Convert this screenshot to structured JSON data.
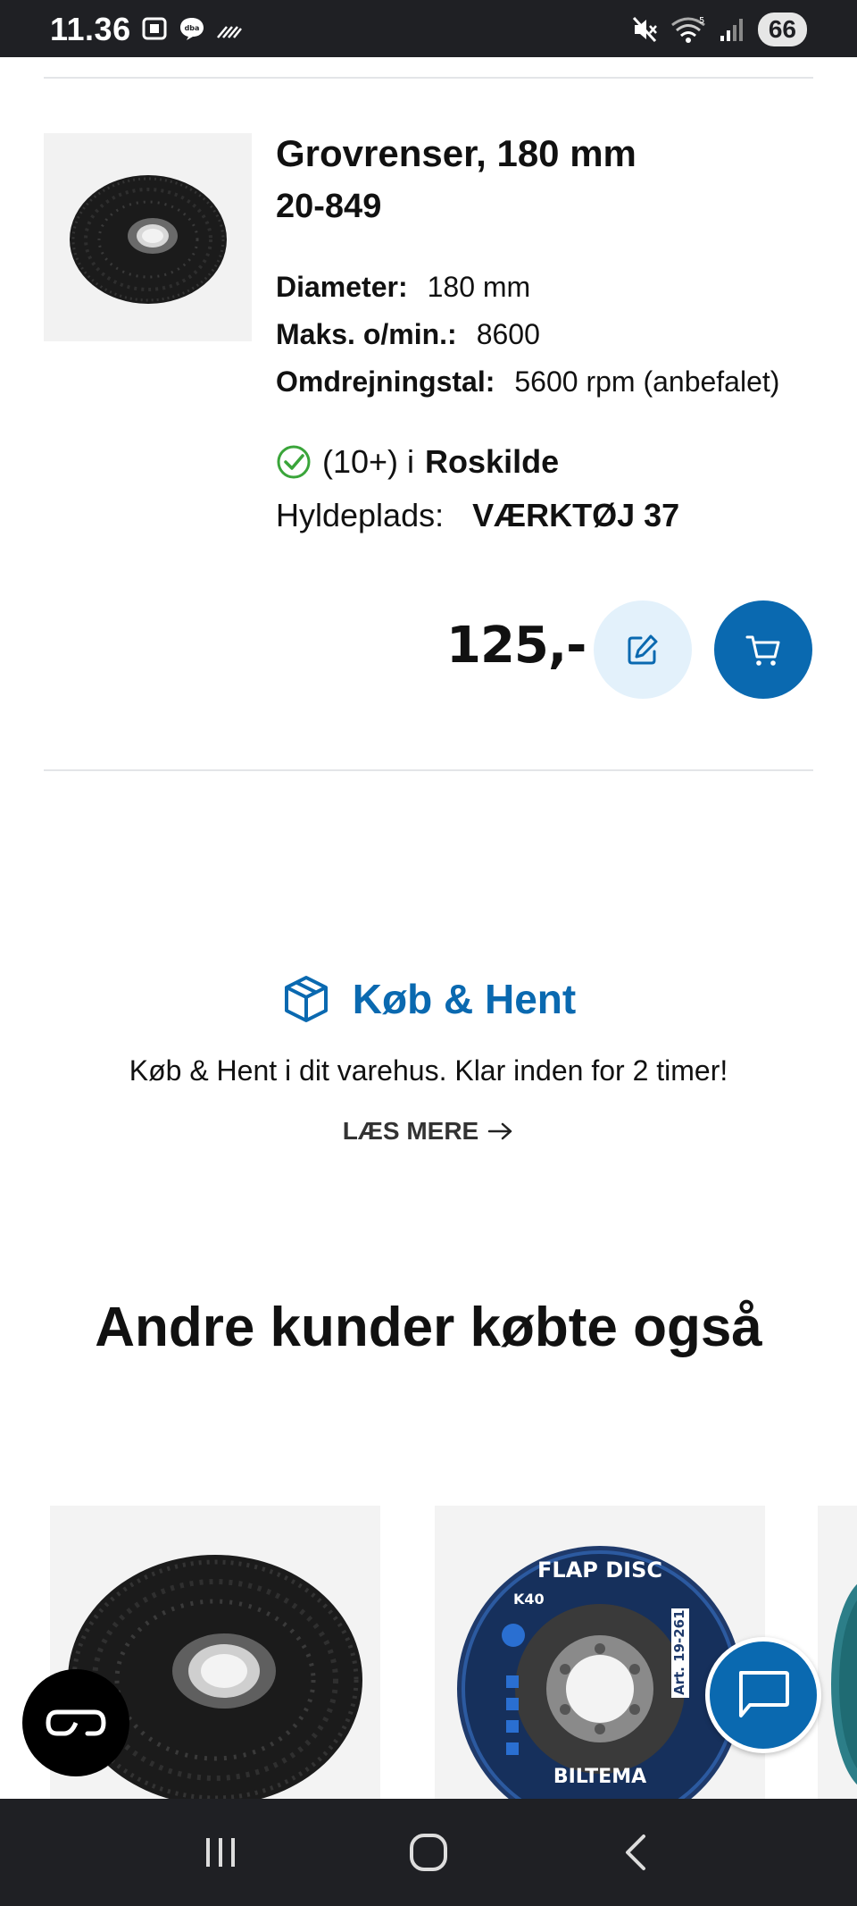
{
  "status_bar": {
    "time": "11.36",
    "battery": "66",
    "icons": [
      "screenshot-icon",
      "dba-chat-icon",
      "signal-noise-icon",
      "mute-icon",
      "wifi-icon",
      "cell-signal-icon"
    ]
  },
  "product": {
    "title": "Grovrenser, 180 mm",
    "sku": "20-849",
    "specs": [
      {
        "label": "Diameter:",
        "value": "180 mm"
      },
      {
        "label": "Maks. o/min.:",
        "value": "8600"
      },
      {
        "label": "Omdrejningstal:",
        "value": "5600 rpm (anbefalet)"
      }
    ],
    "stock_qty": "(10+) i",
    "stock_store": "Roskilde",
    "shelf_label": "Hyldeplads:",
    "shelf_value": "VÆRKTØJ 37",
    "price": "125,-"
  },
  "pickup": {
    "title": "Køb & Hent",
    "text": "Køb & Hent i dit varehus. Klar inden for 2 timer!",
    "link": "LÆS MERE"
  },
  "recommendations": {
    "title": "Andre kunder købte også",
    "flap_disc_text": [
      "FLAP DISC",
      "K40",
      "BILTEMA",
      "Art. 19-261"
    ]
  },
  "colors": {
    "brand_blue": "#0a69b0",
    "light_blue": "#e3f1fb",
    "status_bar": "#1f2024",
    "stock_green": "#3aa53a"
  }
}
